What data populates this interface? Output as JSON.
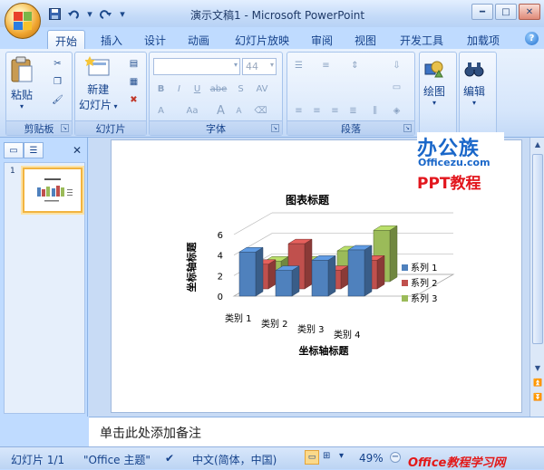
{
  "window": {
    "title": "演示文稿1 - Microsoft PowerPoint",
    "minimize_icon": "minimize-icon",
    "maximize_icon": "maximize-icon",
    "close_icon": "close-icon"
  },
  "quick_access": [
    "save-icon",
    "undo-icon",
    "redo-icon",
    "customize-icon"
  ],
  "tabs": [
    "开始",
    "插入",
    "设计",
    "动画",
    "幻灯片放映",
    "审阅",
    "视图",
    "开发工具",
    "加载项"
  ],
  "active_tab": "开始",
  "ribbon": {
    "clipboard": {
      "label": "剪贴板",
      "paste": "粘贴"
    },
    "slides": {
      "label": "幻灯片",
      "new_slide_1": "新建",
      "new_slide_2": "幻灯片"
    },
    "font": {
      "label": "字体",
      "size": "44",
      "buttons": [
        "B",
        "I",
        "U",
        "abe",
        "S",
        "AV",
        "A",
        "Aa",
        "A",
        "A"
      ]
    },
    "paragraph": {
      "label": "段落"
    },
    "drawing": {
      "label": "绘图"
    },
    "editing": {
      "label": "编辑"
    }
  },
  "slide_panel": {
    "slide_number": "1"
  },
  "chart_data": {
    "type": "bar",
    "title": "图表标题",
    "xlabel": "坐标轴标题",
    "ylabel": "坐标轴标题",
    "categories": [
      "类别 1",
      "类别 2",
      "类别 3",
      "类别 4"
    ],
    "series": [
      {
        "name": "系列 1",
        "values": [
          4.3,
          2.5,
          3.5,
          4.5
        ],
        "color": "#4f81bd"
      },
      {
        "name": "系列 2",
        "values": [
          2.4,
          4.4,
          1.8,
          2.8
        ],
        "color": "#c0504d"
      },
      {
        "name": "系列 3",
        "values": [
          2,
          2,
          3,
          5
        ],
        "color": "#9bbb59"
      }
    ],
    "ylim": [
      0,
      6
    ],
    "yticks": [
      "0",
      "2",
      "4",
      "6"
    ],
    "legend": "right",
    "grid": true
  },
  "notes": {
    "placeholder": "单击此处添加备注"
  },
  "status": {
    "slide_info": "幻灯片 1/1",
    "theme": "\"Office 主题\"",
    "language": "中文(简体，中国)",
    "zoom": "49%"
  },
  "branding": {
    "line1": "办公族",
    "line2": "Officezu.com",
    "line3": "PPT教程"
  },
  "watermark": {
    "text": "Office教程学习网"
  }
}
